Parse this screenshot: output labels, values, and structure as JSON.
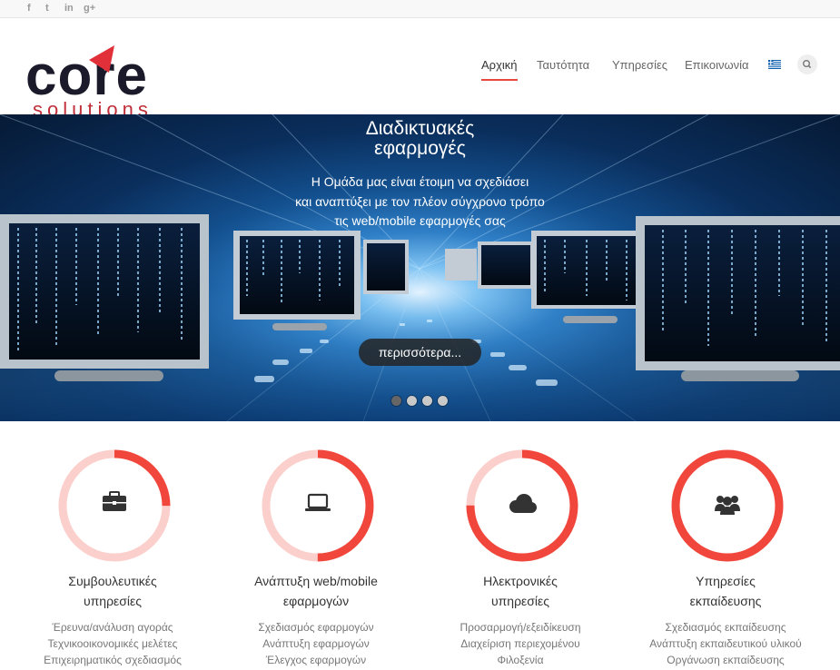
{
  "social": {
    "facebook": "f",
    "twitter": "t",
    "linkedin": "in",
    "googleplus": "g+"
  },
  "logo": {
    "main": "core",
    "sub": "solutions"
  },
  "nav": {
    "items": [
      "Αρχική",
      "Ταυτότητα",
      "Υπηρεσίες",
      "Επικοινωνία"
    ],
    "active": "Αρχική"
  },
  "hero": {
    "title_line1": "Διαδικτυακές",
    "title_line2": "εφαρμογές",
    "sub_line1": "Η Ομάδα μας είναι έτοιμη να σχεδιάσει",
    "sub_line2": "και αναπτύξει με τον πλέον σύγχρονο τρόπο",
    "sub_line3": "τις web/mobile εφαρμογές σας",
    "button": "περισσότερα...",
    "slides_count": 4,
    "active_slide": 1
  },
  "colors": {
    "accent": "#f1463c",
    "ring_light": "#fbd0cc"
  },
  "services": [
    {
      "icon": "briefcase-icon",
      "progress": 0.25,
      "title_line1": "Συμβουλευτικές",
      "title_line2": "υπηρεσίες",
      "items": [
        "Έρευνα/ανάλυση αγοράς",
        "Τεχνικοοικονομικές μελέτες",
        "Επιχειρηματικός σχεδιασμός"
      ]
    },
    {
      "icon": "laptop-icon",
      "progress": 0.5,
      "title_line1": "Ανάπτυξη web/mobile",
      "title_line2": "εφαρμογών",
      "items": [
        "Σχεδιασμός εφαρμογών",
        "Ανάπτυξη εφαρμογών",
        "Έλεγχος εφαρμογών"
      ]
    },
    {
      "icon": "cloud-icon",
      "progress": 0.75,
      "title_line1": "Ηλεκτρονικές",
      "title_line2": "υπηρεσίες",
      "items": [
        "Προσαρμογή/εξειδίκευση",
        "Διαχείριση περιεχομένου",
        "Φιλοξενία"
      ]
    },
    {
      "icon": "users-icon",
      "progress": 1.0,
      "title_line1": "Υπηρεσίες",
      "title_line2": "εκπαίδευσης",
      "items": [
        "Σχεδιασμός εκπαίδευσης",
        "Ανάπτυξη εκπαιδευτικού υλικού",
        "Οργάνωση εκπαίδευσης"
      ]
    }
  ]
}
